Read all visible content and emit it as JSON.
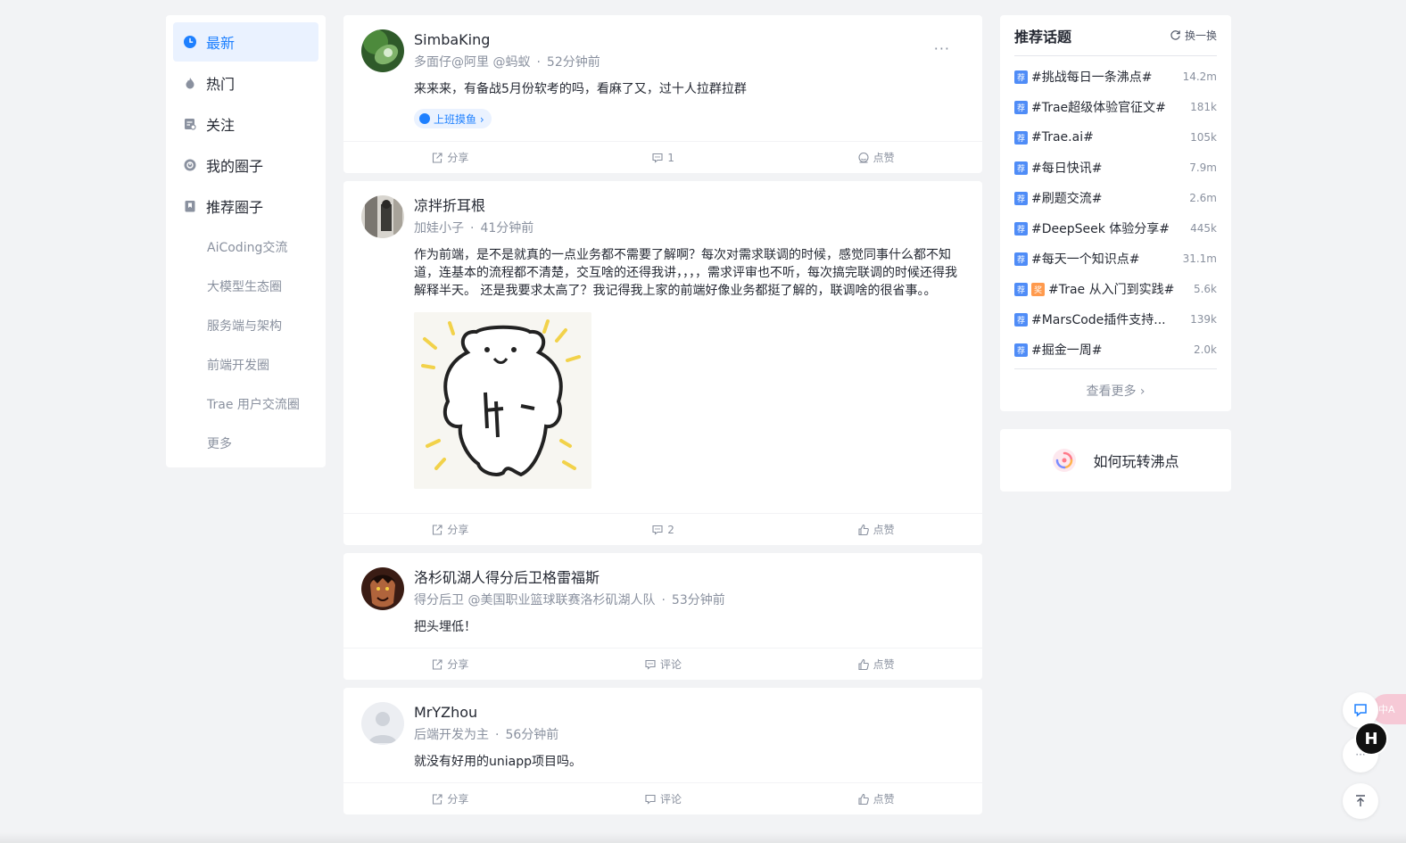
{
  "nav": {
    "items": [
      {
        "label": "最新",
        "icon": "clock-icon",
        "active": true
      },
      {
        "label": "热门",
        "icon": "flame-icon",
        "active": false
      },
      {
        "label": "关注",
        "icon": "follow-icon",
        "active": false
      },
      {
        "label": "我的圈子",
        "icon": "circle-icon",
        "active": false
      },
      {
        "label": "推荐圈子",
        "icon": "bookmark-icon",
        "active": false
      }
    ],
    "sub_items": [
      "AiCoding交流",
      "大模型生态圈",
      "服务端与架构",
      "前端开发圈",
      "Trae 用户交流圈",
      "更多"
    ]
  },
  "posts": [
    {
      "author": "SimbaKing",
      "subtitle": "多面仔@阿里 @蚂蚁",
      "time": "52分钟前",
      "content": "来来来，有备战5月份软考的吗，看麻了又，过十人拉群拉群",
      "topic_tag": "上班摸鱼 ›",
      "share": "分享",
      "comment": "1",
      "like": "点赞"
    },
    {
      "author": "凉拌折耳根",
      "subtitle": "加娃小子",
      "time": "41分钟前",
      "content": "作为前端，是不是就真的一点业务都不需要了解啊？每次对需求联调的时候，感觉同事什么都不知道，连基本的流程都不清楚，交互啥的还得我讲，，，，需求评审也不听，每次搞完联调的时候还得我解释半天。 还是我要求太高了？我记得我上家的前端好像业务都挺了解的，联调啥的很省事。。",
      "image_caption": "bear-meme",
      "share": "分享",
      "comment": "2",
      "like": "点赞"
    },
    {
      "author": "洛杉矶湖人得分后卫格雷福斯",
      "subtitle": "得分后卫 @美国职业篮球联赛洛杉矶湖人队",
      "time": "53分钟前",
      "content": "把头埋低！",
      "share": "分享",
      "comment": "评论",
      "like": "点赞"
    },
    {
      "author": "MrYZhou",
      "subtitle": "后端开发为主",
      "time": "56分钟前",
      "content": "就没有好用的uniapp项目吗。",
      "share": "分享",
      "comment": "评论",
      "like": "点赞"
    }
  ],
  "topics": {
    "title": "推荐话题",
    "refresh": "换一换",
    "badge": "荐",
    "hot_badge": "奖",
    "items": [
      {
        "name": "#挑战每日一条沸点#",
        "count": "14.2m",
        "hot": false
      },
      {
        "name": "#Trae超级体验官征文#",
        "count": "181k",
        "hot": false
      },
      {
        "name": "#Trae.ai#",
        "count": "105k",
        "hot": false
      },
      {
        "name": "#每日快讯#",
        "count": "7.9m",
        "hot": false
      },
      {
        "name": "#刷题交流#",
        "count": "2.6m",
        "hot": false
      },
      {
        "name": "#DeepSeek 体验分享#",
        "count": "445k",
        "hot": false
      },
      {
        "name": "#每天一个知识点#",
        "count": "31.1m",
        "hot": false
      },
      {
        "name": "#Trae 从入门到实践#",
        "count": "5.6k",
        "hot": true
      },
      {
        "name": "#MarsCode插件支持...",
        "count": "139k",
        "hot": false
      },
      {
        "name": "#掘金一周#",
        "count": "2.0k",
        "hot": false
      }
    ],
    "more": "查看更多 ›"
  },
  "guide": {
    "label": "如何玩转沸点"
  },
  "float": {
    "h_label": "H",
    "translate_label": "中A",
    "more_label": "···"
  },
  "colors": {
    "accent": "#1e80ff",
    "bg": "#f2f3f5",
    "muted": "#8a919f"
  }
}
